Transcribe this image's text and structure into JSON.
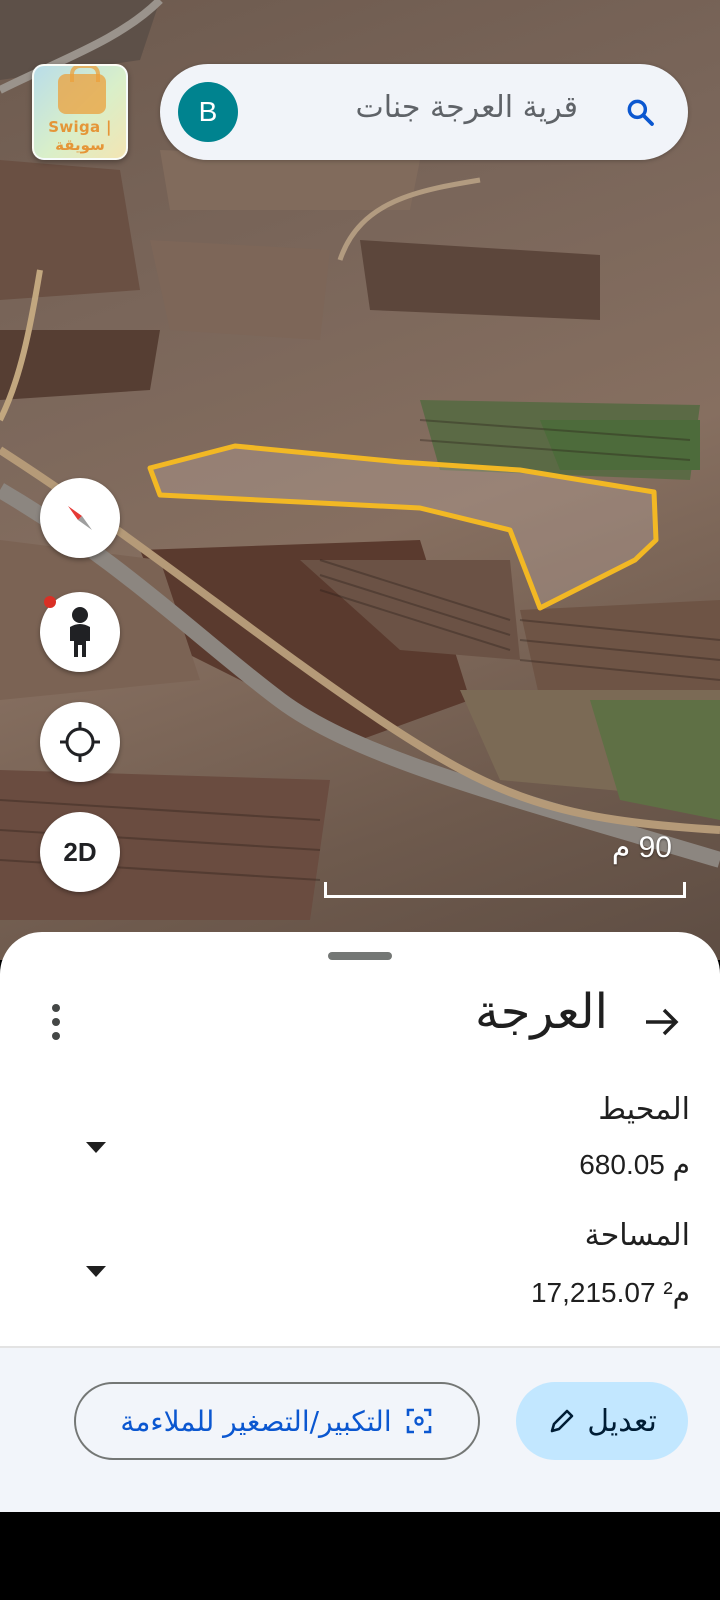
{
  "branding": {
    "watermark": "Swiga | سويقة"
  },
  "search": {
    "avatar_letter": "B",
    "query": "قرية العرجة جنات"
  },
  "map_controls": {
    "mode_label": "2D"
  },
  "scale": {
    "label": "90 م"
  },
  "sheet": {
    "title": "العرجة",
    "perimeter": {
      "label": "المحيط",
      "value": "680.05 م"
    },
    "area": {
      "label": "المساحة",
      "value": "17,215.07 م²"
    }
  },
  "actions": {
    "edit_label": "تعديل",
    "fit_label": "التكبير/التصغير للملاءمة"
  },
  "colors": {
    "polygon_outline": "#f2b824",
    "accent": "#0b57d0",
    "edit_bg": "#c2e7ff",
    "avatar_bg": "#00838f"
  }
}
